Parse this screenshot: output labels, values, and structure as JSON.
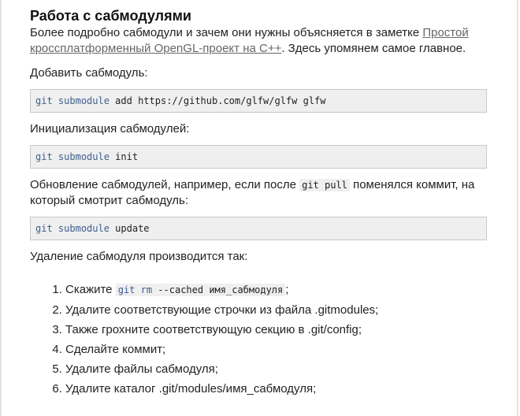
{
  "heading": "Работа с сабмодулями",
  "intro": {
    "before_link": "Более подробно сабмодули и зачем они нужны объясняется в заметке ",
    "link_text": "Простой кроссплатформенный OpenGL-проект на C++",
    "after_link": ". Здесь упомянем самое главное."
  },
  "add": {
    "label": "Добавить сабмодуль:",
    "code_git": "git",
    "code_sub": "submodule",
    "code_rest": " add https://github.com/glfw/glfw glfw"
  },
  "init": {
    "label": "Инициализация сабмодулей:",
    "code_git": "git",
    "code_sub": "submodule",
    "code_rest": " init"
  },
  "update": {
    "label_before": "Обновление сабмодулей, например, если после ",
    "label_code": "git pull",
    "label_after": " поменялся коммит, на который смотрит сабмодуль:",
    "code_git": "git",
    "code_sub": "submodule",
    "code_rest": " update"
  },
  "remove": {
    "label": "Удаление сабмодуля производится так:",
    "step1_before": "Скажите ",
    "step1_code_git": "git",
    "step1_code_rm": "rm",
    "step1_code_rest": " --cached имя_сабмодуля",
    "step1_after": ";",
    "steps": [
      "Удалите соответствующие строчки из файла .gitmodules;",
      "Также грохните соответствующую секцию в .git/config;",
      "Сделайте коммит;",
      "Удалите файлы сабмодуля;",
      "Удалите каталог .git/modules/имя_сабмодуля;"
    ]
  }
}
